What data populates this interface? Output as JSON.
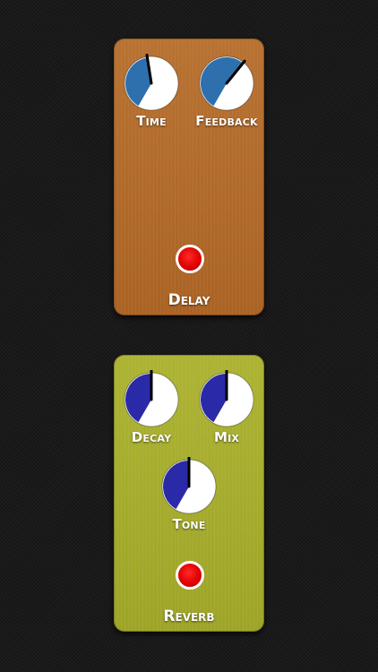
{
  "colors": {
    "background": "#1a1a1a",
    "delay_pedal": "#b26a2b",
    "reverb_pedal": "#a6ac2d",
    "knob_face": "#ffffff",
    "delay_knob_fill": "#2e6fae",
    "reverb_knob_fill": "#2a2aa8",
    "led": "#e10000",
    "label": "#ffffff"
  },
  "pedals": [
    {
      "name": "Delay",
      "knobs": [
        {
          "label": "Time",
          "level": 0.47
        },
        {
          "label": "Feedback",
          "level": 0.63
        }
      ],
      "led_on": true
    },
    {
      "name": "Reverb",
      "knobs": [
        {
          "label": "Decay",
          "level": 0.5
        },
        {
          "label": "Mix",
          "level": 0.5
        },
        {
          "label": "Tone",
          "level": 0.5
        }
      ],
      "led_on": true
    }
  ]
}
